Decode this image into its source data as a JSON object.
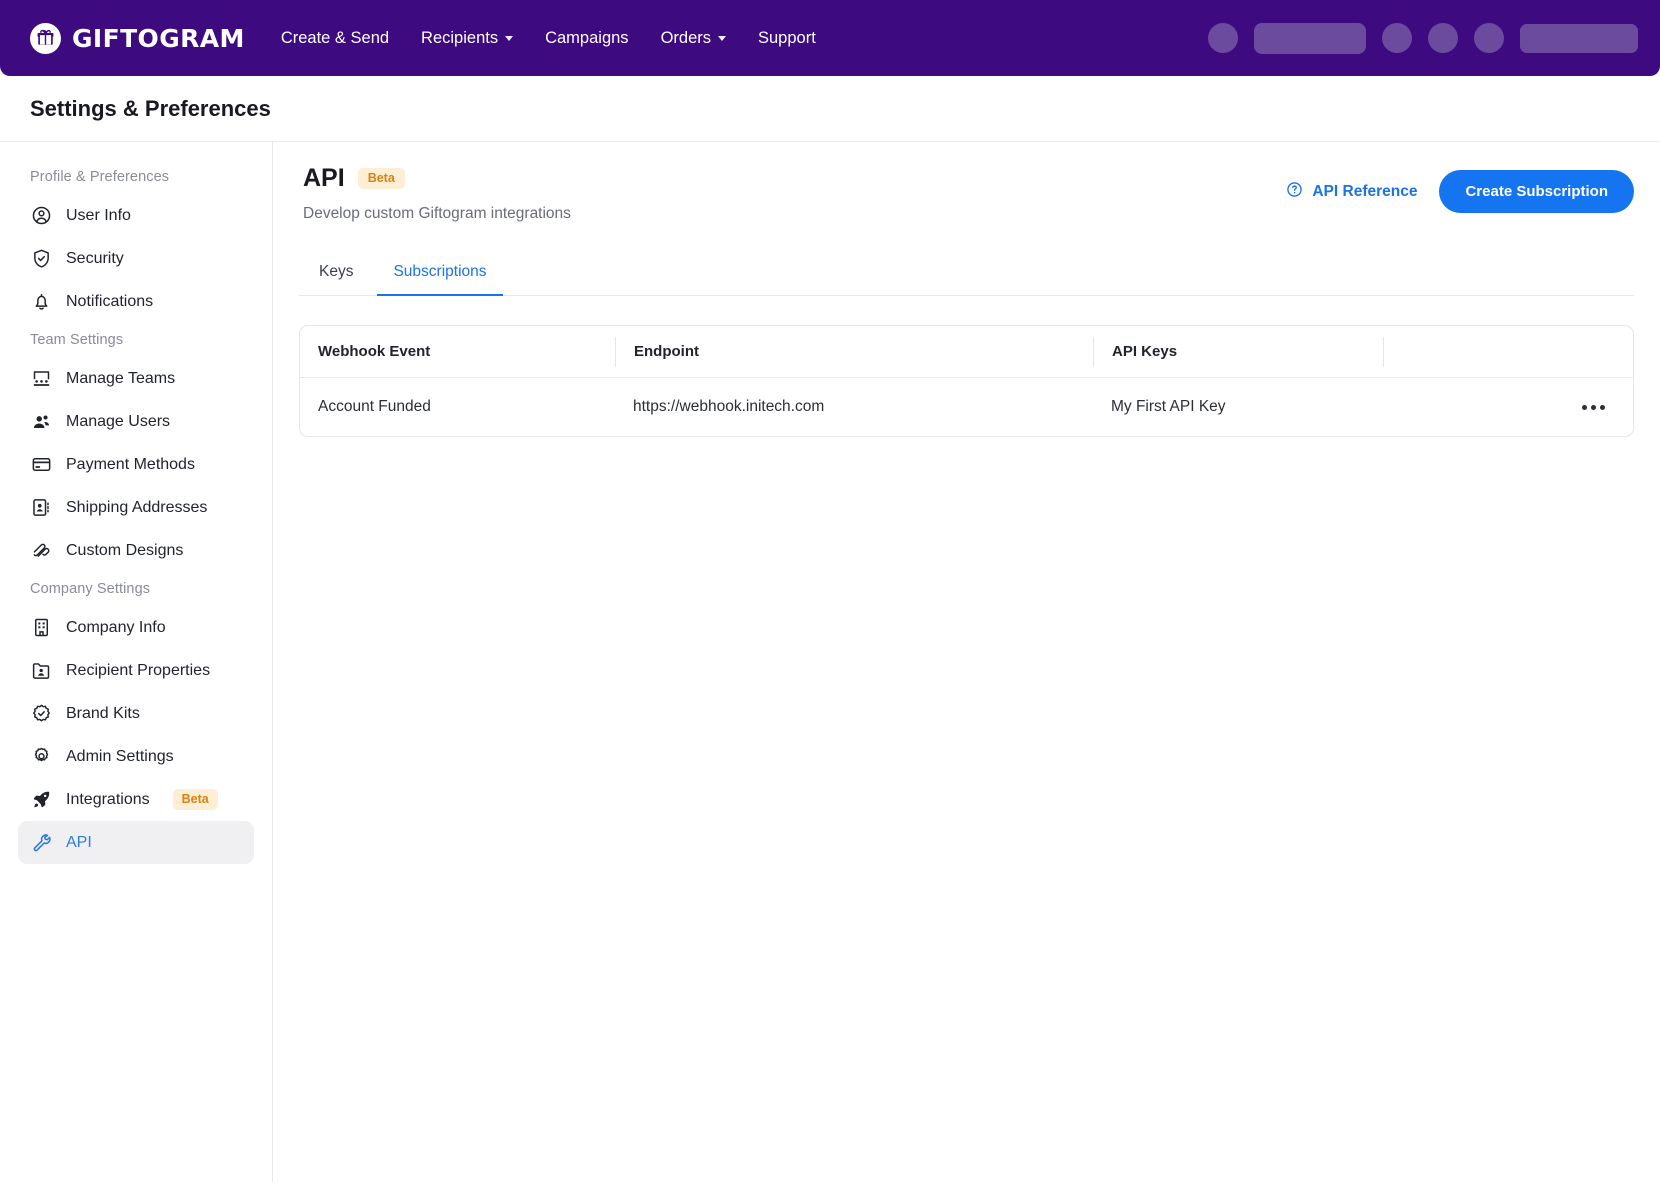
{
  "topnav": {
    "brand": "GIFTOGRAM",
    "brand_icon": "gift-icon",
    "links": [
      {
        "label": "Create & Send",
        "has_caret": false
      },
      {
        "label": "Recipients",
        "has_caret": true
      },
      {
        "label": "Campaigns",
        "has_caret": false
      },
      {
        "label": "Orders",
        "has_caret": true
      },
      {
        "label": "Support",
        "has_caret": false
      }
    ],
    "bg_color": "#3d0a80",
    "skeleton_color": "#6b4b9e"
  },
  "page": {
    "title": "Settings & Preferences"
  },
  "sidebar": {
    "groups": [
      {
        "label": "Profile & Preferences",
        "items": [
          {
            "label": "User Info",
            "icon": "user-circle-icon",
            "active": false
          },
          {
            "label": "Security",
            "icon": "shield-check-icon",
            "active": false
          },
          {
            "label": "Notifications",
            "icon": "bell-icon",
            "active": false
          }
        ]
      },
      {
        "label": "Team Settings",
        "items": [
          {
            "label": "Manage Teams",
            "icon": "teams-icon",
            "active": false
          },
          {
            "label": "Manage Users",
            "icon": "users-icon",
            "active": false
          },
          {
            "label": "Payment Methods",
            "icon": "credit-card-icon",
            "active": false
          },
          {
            "label": "Shipping Addresses",
            "icon": "address-book-icon",
            "active": false
          },
          {
            "label": "Custom Designs",
            "icon": "brush-strokes-icon",
            "active": false
          }
        ]
      },
      {
        "label": "Company Settings",
        "items": [
          {
            "label": "Company Info",
            "icon": "building-icon",
            "active": false
          },
          {
            "label": "Recipient Properties",
            "icon": "folder-user-icon",
            "active": false
          },
          {
            "label": "Brand Kits",
            "icon": "badge-check-icon",
            "active": false
          },
          {
            "label": "Admin Settings",
            "icon": "gear-icon",
            "active": false
          },
          {
            "label": "Integrations",
            "icon": "rocket-icon",
            "active": false,
            "badge": "Beta"
          },
          {
            "label": "API",
            "icon": "wrench-icon",
            "active": true
          }
        ]
      }
    ]
  },
  "main": {
    "title": "API",
    "badge": "Beta",
    "subtitle": "Develop custom Giftogram integrations",
    "api_reference_label": "API Reference",
    "api_reference_icon": "help-circle-icon",
    "create_button": "Create Subscription",
    "accent_color": "#1574f0",
    "badge_bg": "#fdeed4",
    "badge_color": "#d98213",
    "tabs": [
      {
        "label": "Keys",
        "active": false
      },
      {
        "label": "Subscriptions",
        "active": true
      }
    ],
    "table": {
      "columns": [
        "Webhook Event",
        "Endpoint",
        "API Keys",
        ""
      ],
      "rows": [
        {
          "webhook_event": "Account Funded",
          "endpoint": "https://webhook.initech.com",
          "api_keys": "My First API Key",
          "actions_icon": "ellipsis-horizontal-icon"
        }
      ]
    }
  }
}
